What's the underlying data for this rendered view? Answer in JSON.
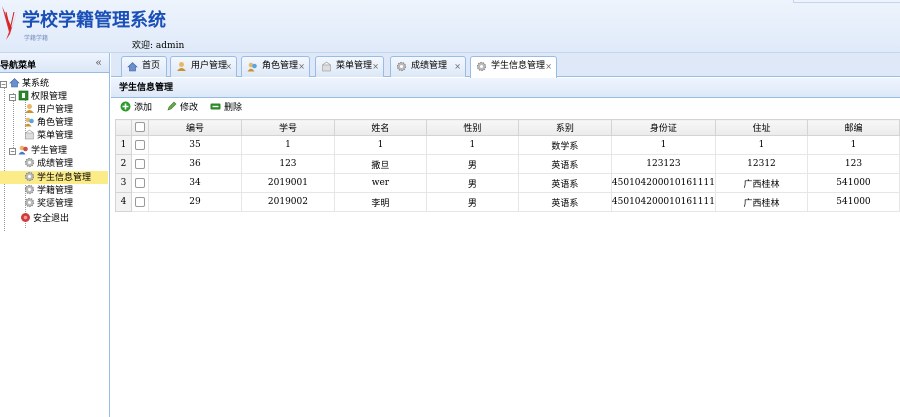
{
  "header": {
    "app_title": "学校学籍管理系统",
    "app_subtitle": "学籍学籍",
    "welcome_label": "欢迎:",
    "username": "admin"
  },
  "sidebar": {
    "title": "导航菜单",
    "collapse_glyph": "«",
    "tree": {
      "root": "某系统",
      "groups": [
        {
          "label": "权限管理",
          "items": [
            "用户管理",
            "角色管理",
            "菜单管理"
          ]
        },
        {
          "label": "学生管理",
          "items": [
            "成绩管理",
            "学生信息管理",
            "学籍管理",
            "奖惩管理"
          ]
        }
      ],
      "logout": "安全退出",
      "selected": "学生信息管理"
    }
  },
  "tabs": [
    {
      "label": "首页",
      "icon": "home-icon",
      "closable": false
    },
    {
      "label": "用户管理",
      "icon": "user-icon",
      "closable": true
    },
    {
      "label": "角色管理",
      "icon": "role-icon",
      "closable": true
    },
    {
      "label": "菜单管理",
      "icon": "menu-icon",
      "closable": true
    },
    {
      "label": "成绩管理",
      "icon": "gear-icon",
      "closable": true
    },
    {
      "label": "学生信息管理",
      "icon": "gear-icon",
      "closable": true,
      "active": true
    }
  ],
  "close_glyph": "×",
  "panel": {
    "title": "学生信息管理",
    "toolbar": {
      "add": "添加",
      "edit": "修改",
      "delete": "删除"
    }
  },
  "table": {
    "columns": [
      "编号",
      "学号",
      "姓名",
      "性别",
      "系别",
      "身份证",
      "住址",
      "邮编"
    ],
    "rows": [
      {
        "rownum": "1",
        "cells": [
          "35",
          "1",
          "1",
          "1",
          "数学系",
          "1",
          "1",
          "1"
        ]
      },
      {
        "rownum": "2",
        "cells": [
          "36",
          "123",
          "撒旦",
          "男",
          "英语系",
          "123123",
          "12312",
          "123"
        ]
      },
      {
        "rownum": "3",
        "cells": [
          "34",
          "2019001",
          "wer",
          "男",
          "英语系",
          "450104200010161111",
          "广西桂林",
          "541000"
        ]
      },
      {
        "rownum": "4",
        "cells": [
          "29",
          "2019002",
          "李明",
          "男",
          "英语系",
          "450104200010161111",
          "广西桂林",
          "541000"
        ]
      }
    ]
  },
  "colors": {
    "header_bg": "#e6eefb",
    "title_blue": "#1a4fb8",
    "border_blue": "#99bbe8",
    "selected_node": "#fbec88"
  }
}
